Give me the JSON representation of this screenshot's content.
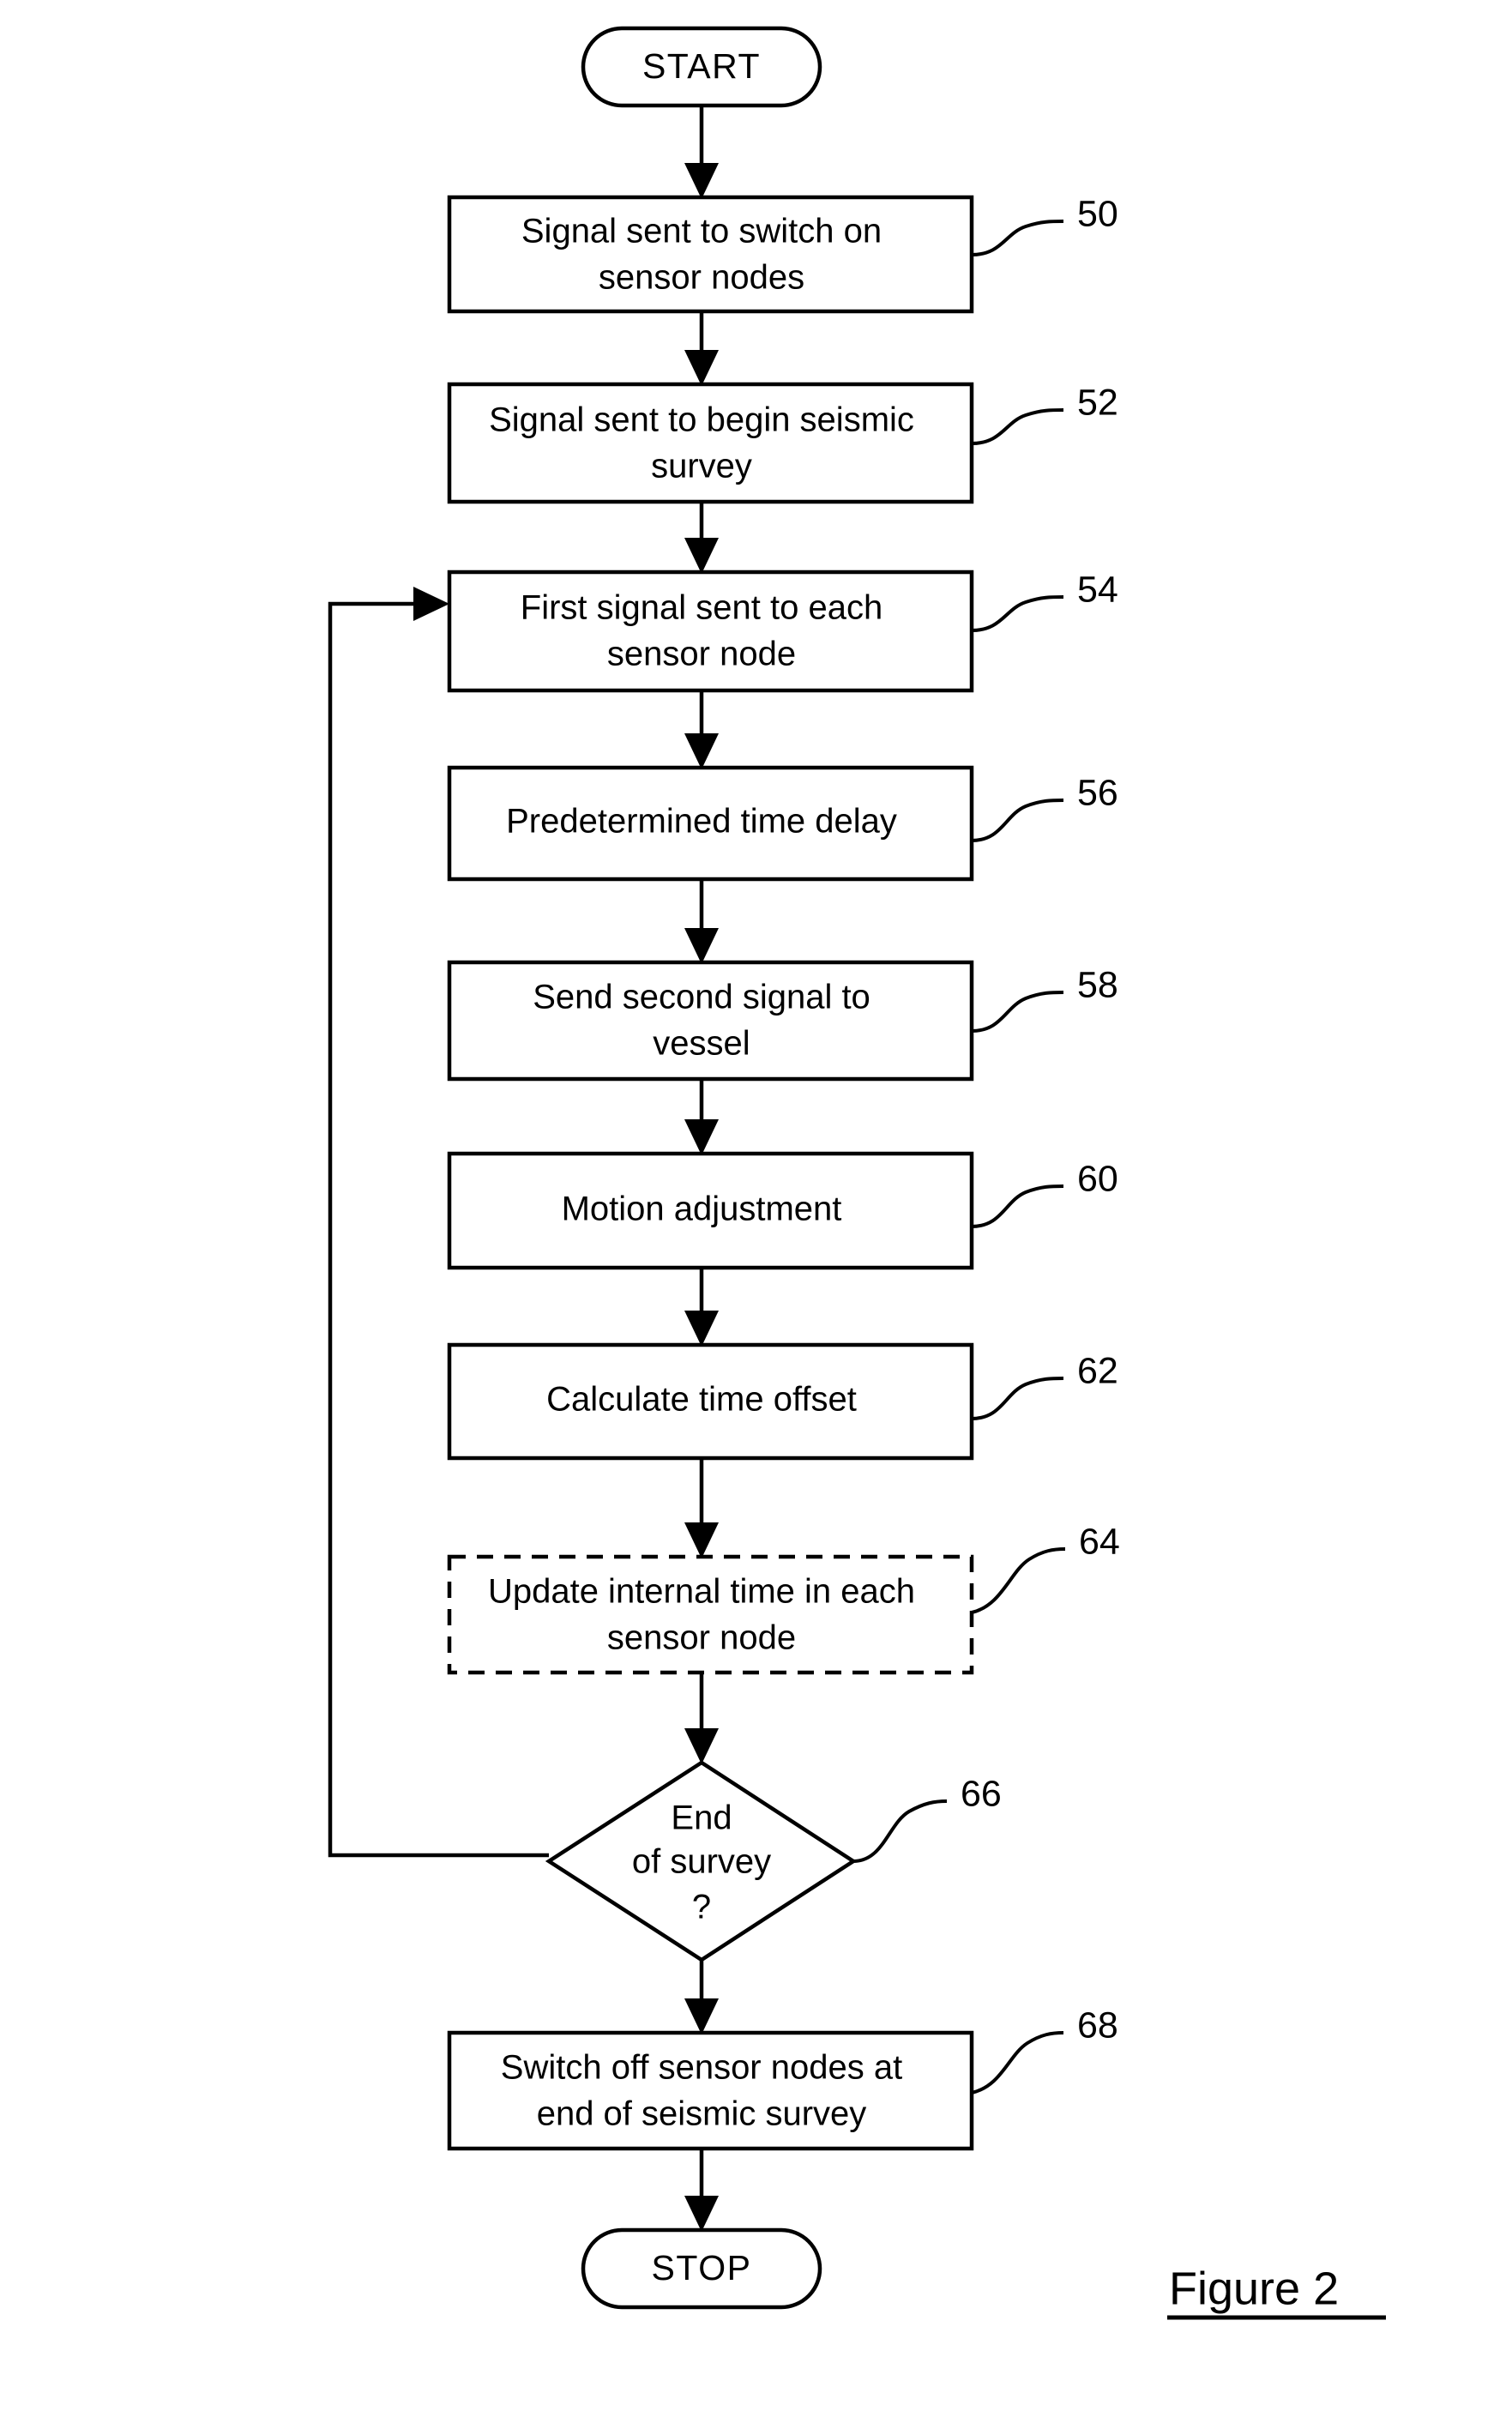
{
  "figure": {
    "caption": "Figure 2",
    "title": "Figure 2"
  },
  "terminals": {
    "start": "START",
    "stop": "STOP"
  },
  "nodes": [
    {
      "id": "node-50",
      "ref": "50",
      "shape": "process",
      "lines": [
        "Signal sent to switch on",
        "sensor nodes"
      ]
    },
    {
      "id": "node-52",
      "ref": "52",
      "shape": "process",
      "lines": [
        "Signal sent to begin seismic",
        "survey"
      ]
    },
    {
      "id": "node-54",
      "ref": "54",
      "shape": "process",
      "lines": [
        "First signal sent to each",
        "sensor node"
      ]
    },
    {
      "id": "node-56",
      "ref": "56",
      "shape": "process",
      "lines": [
        "Predetermined time delay"
      ]
    },
    {
      "id": "node-58",
      "ref": "58",
      "shape": "process",
      "lines": [
        "Send second signal to",
        "vessel"
      ]
    },
    {
      "id": "node-60",
      "ref": "60",
      "shape": "process",
      "lines": [
        "Motion adjustment"
      ]
    },
    {
      "id": "node-62",
      "ref": "62",
      "shape": "process",
      "lines": [
        "Calculate time offset"
      ]
    },
    {
      "id": "node-64",
      "ref": "64",
      "shape": "process-dashed",
      "lines": [
        "Update internal time in each",
        "sensor node"
      ]
    },
    {
      "id": "node-66",
      "ref": "66",
      "shape": "decision",
      "lines": [
        "End",
        "of survey",
        "?"
      ]
    },
    {
      "id": "node-68",
      "ref": "68",
      "shape": "process",
      "lines": [
        "Switch off sensor nodes at",
        "end of seismic survey"
      ]
    }
  ],
  "colors": {
    "line": "#000000",
    "background": "#ffffff",
    "text": "#000000"
  }
}
